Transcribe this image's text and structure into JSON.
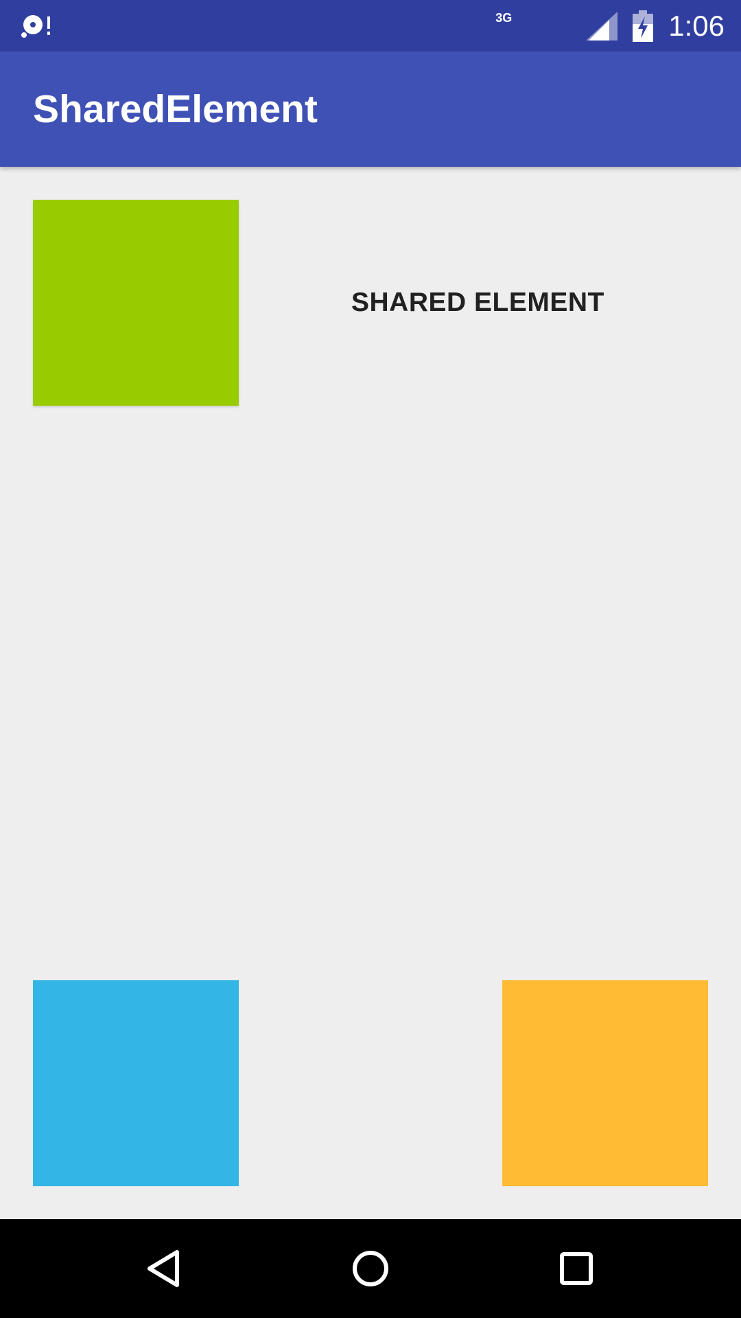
{
  "status_bar": {
    "network_type": "3G",
    "time": "1:06",
    "icons": [
      "sync-disc-alert-icon",
      "signal-icon",
      "battery-charging-icon"
    ],
    "bg_color": "#303f9f"
  },
  "app_bar": {
    "title": "SharedElement",
    "bg_color": "#3f51b5"
  },
  "content": {
    "label": "SHARED ELEMENT",
    "squares": [
      {
        "name": "green",
        "color": "#99cc00"
      },
      {
        "name": "blue",
        "color": "#33b5e5"
      },
      {
        "name": "orange",
        "color": "#ffbb33"
      }
    ],
    "bg_color": "#eeeeee"
  },
  "nav_bar": {
    "buttons": [
      "back-icon",
      "home-icon",
      "recents-icon"
    ]
  }
}
